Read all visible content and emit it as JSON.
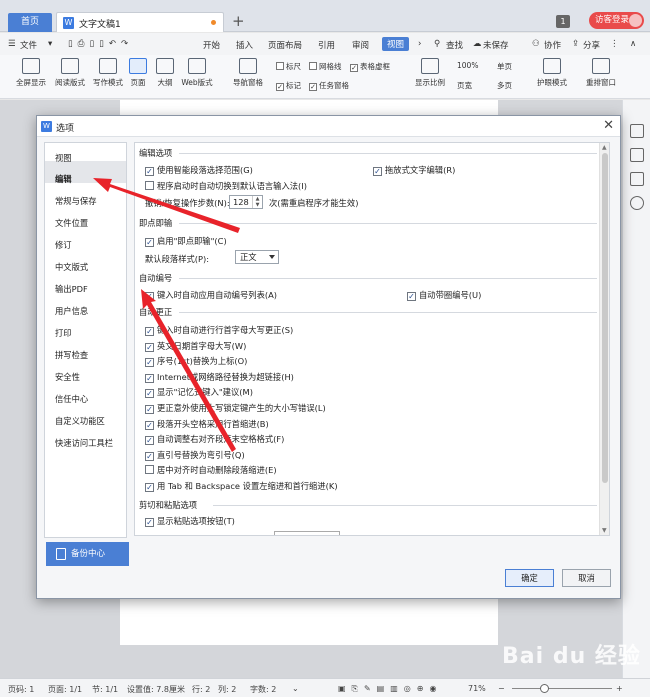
{
  "titlebar": {
    "home_tab": "首页",
    "doc_tab": "文字文稿1",
    "doc_icon": "W",
    "add_tab": "+",
    "badge": "1",
    "login": "访客登录"
  },
  "menubar": {
    "items": [
      "文件",
      "开始",
      "插入",
      "页面布局",
      "引用",
      "审阅",
      "视图",
      "查找",
      "未保存",
      "协作",
      "分享"
    ],
    "active": "视图"
  },
  "ribbon": {
    "buttons": [
      "全屏显示",
      "阅读版式",
      "写作模式",
      "页面",
      "大纲",
      "Web版式",
      "导航窗格",
      "显示比例",
      "100%",
      "页宽",
      "单页",
      "多页",
      "护眼模式",
      "重排窗口"
    ],
    "checks": [
      {
        "label": "标尺",
        "checked": false
      },
      {
        "label": "网格线",
        "checked": false
      },
      {
        "label": "表格虚框",
        "checked": true
      },
      {
        "label": "标记",
        "checked": true
      },
      {
        "label": "任务窗格",
        "checked": true
      }
    ]
  },
  "dialog": {
    "title": "选项",
    "nav": [
      "视图",
      "编辑",
      "常规与保存",
      "文件位置",
      "修订",
      "中文版式",
      "输出PDF",
      "用户信息",
      "打印",
      "拼写检查",
      "安全性",
      "信任中心",
      "自定义功能区",
      "快速访问工具栏"
    ],
    "nav_selected": "编辑",
    "backup": "备份中心",
    "sections": {
      "edit": "编辑选项",
      "click_type": "即点即输",
      "autonumber": "自动编号",
      "autocorrect": "自动更正",
      "cut_paste": "剪切和粘贴选项"
    },
    "edit_options": {
      "smart_select": "使用智能段落选择范围(G)",
      "drag_drop": "拖放式文字编辑(R)",
      "auto_ime": "程序启动时自动切换到默认语言输入法(I)",
      "undo_label": "撤销/恢复操作步数(N):",
      "undo_value": "128",
      "undo_note": "次(需重启程序才能生效)"
    },
    "click_type": {
      "enable": "启用\"即点即输\"(C)",
      "style_label": "默认段落样式(P):",
      "style_value": "正文"
    },
    "autonumber": {
      "auto_list": "键入时自动应用自动编号列表(A)",
      "auto_bullet": "自动带圈编号(U)"
    },
    "autocorrect": [
      "键入时自动进行行首字母大写更正(S)",
      "英文日期首字母大写(W)",
      "序号(1st)替换为上标(O)",
      "Internet或网络路径替换为超链接(H)",
      "显示\"记忆式键入\"建议(M)",
      "更正意外使用大写锁定键产生的大小写错误(L)",
      "段落开头空格采用行首缩进(B)",
      "自动调整右对齐段落末空格格式(F)",
      "直引号替换为弯引号(Q)",
      "居中对齐时自动删除段落缩进(E)",
      "用 Tab 和 Backspace 设置左缩进和首行缩进(K)"
    ],
    "autocorrect_checked": [
      true,
      true,
      true,
      true,
      true,
      true,
      true,
      true,
      true,
      false,
      true
    ],
    "cut_paste": {
      "show_paste_btn": "显示粘贴选项按钮(T)"
    },
    "ok": "确定",
    "cancel": "取消"
  },
  "statusbar": {
    "page": "页码: 1",
    "pages": "页面: 1/1",
    "section": "节: 1/1",
    "setting": "设置值: 7.8厘米",
    "row": "行: 2",
    "col": "列: 2",
    "words": "字数: 2",
    "zoom": "71%"
  },
  "watermark": "Bai du 经验"
}
